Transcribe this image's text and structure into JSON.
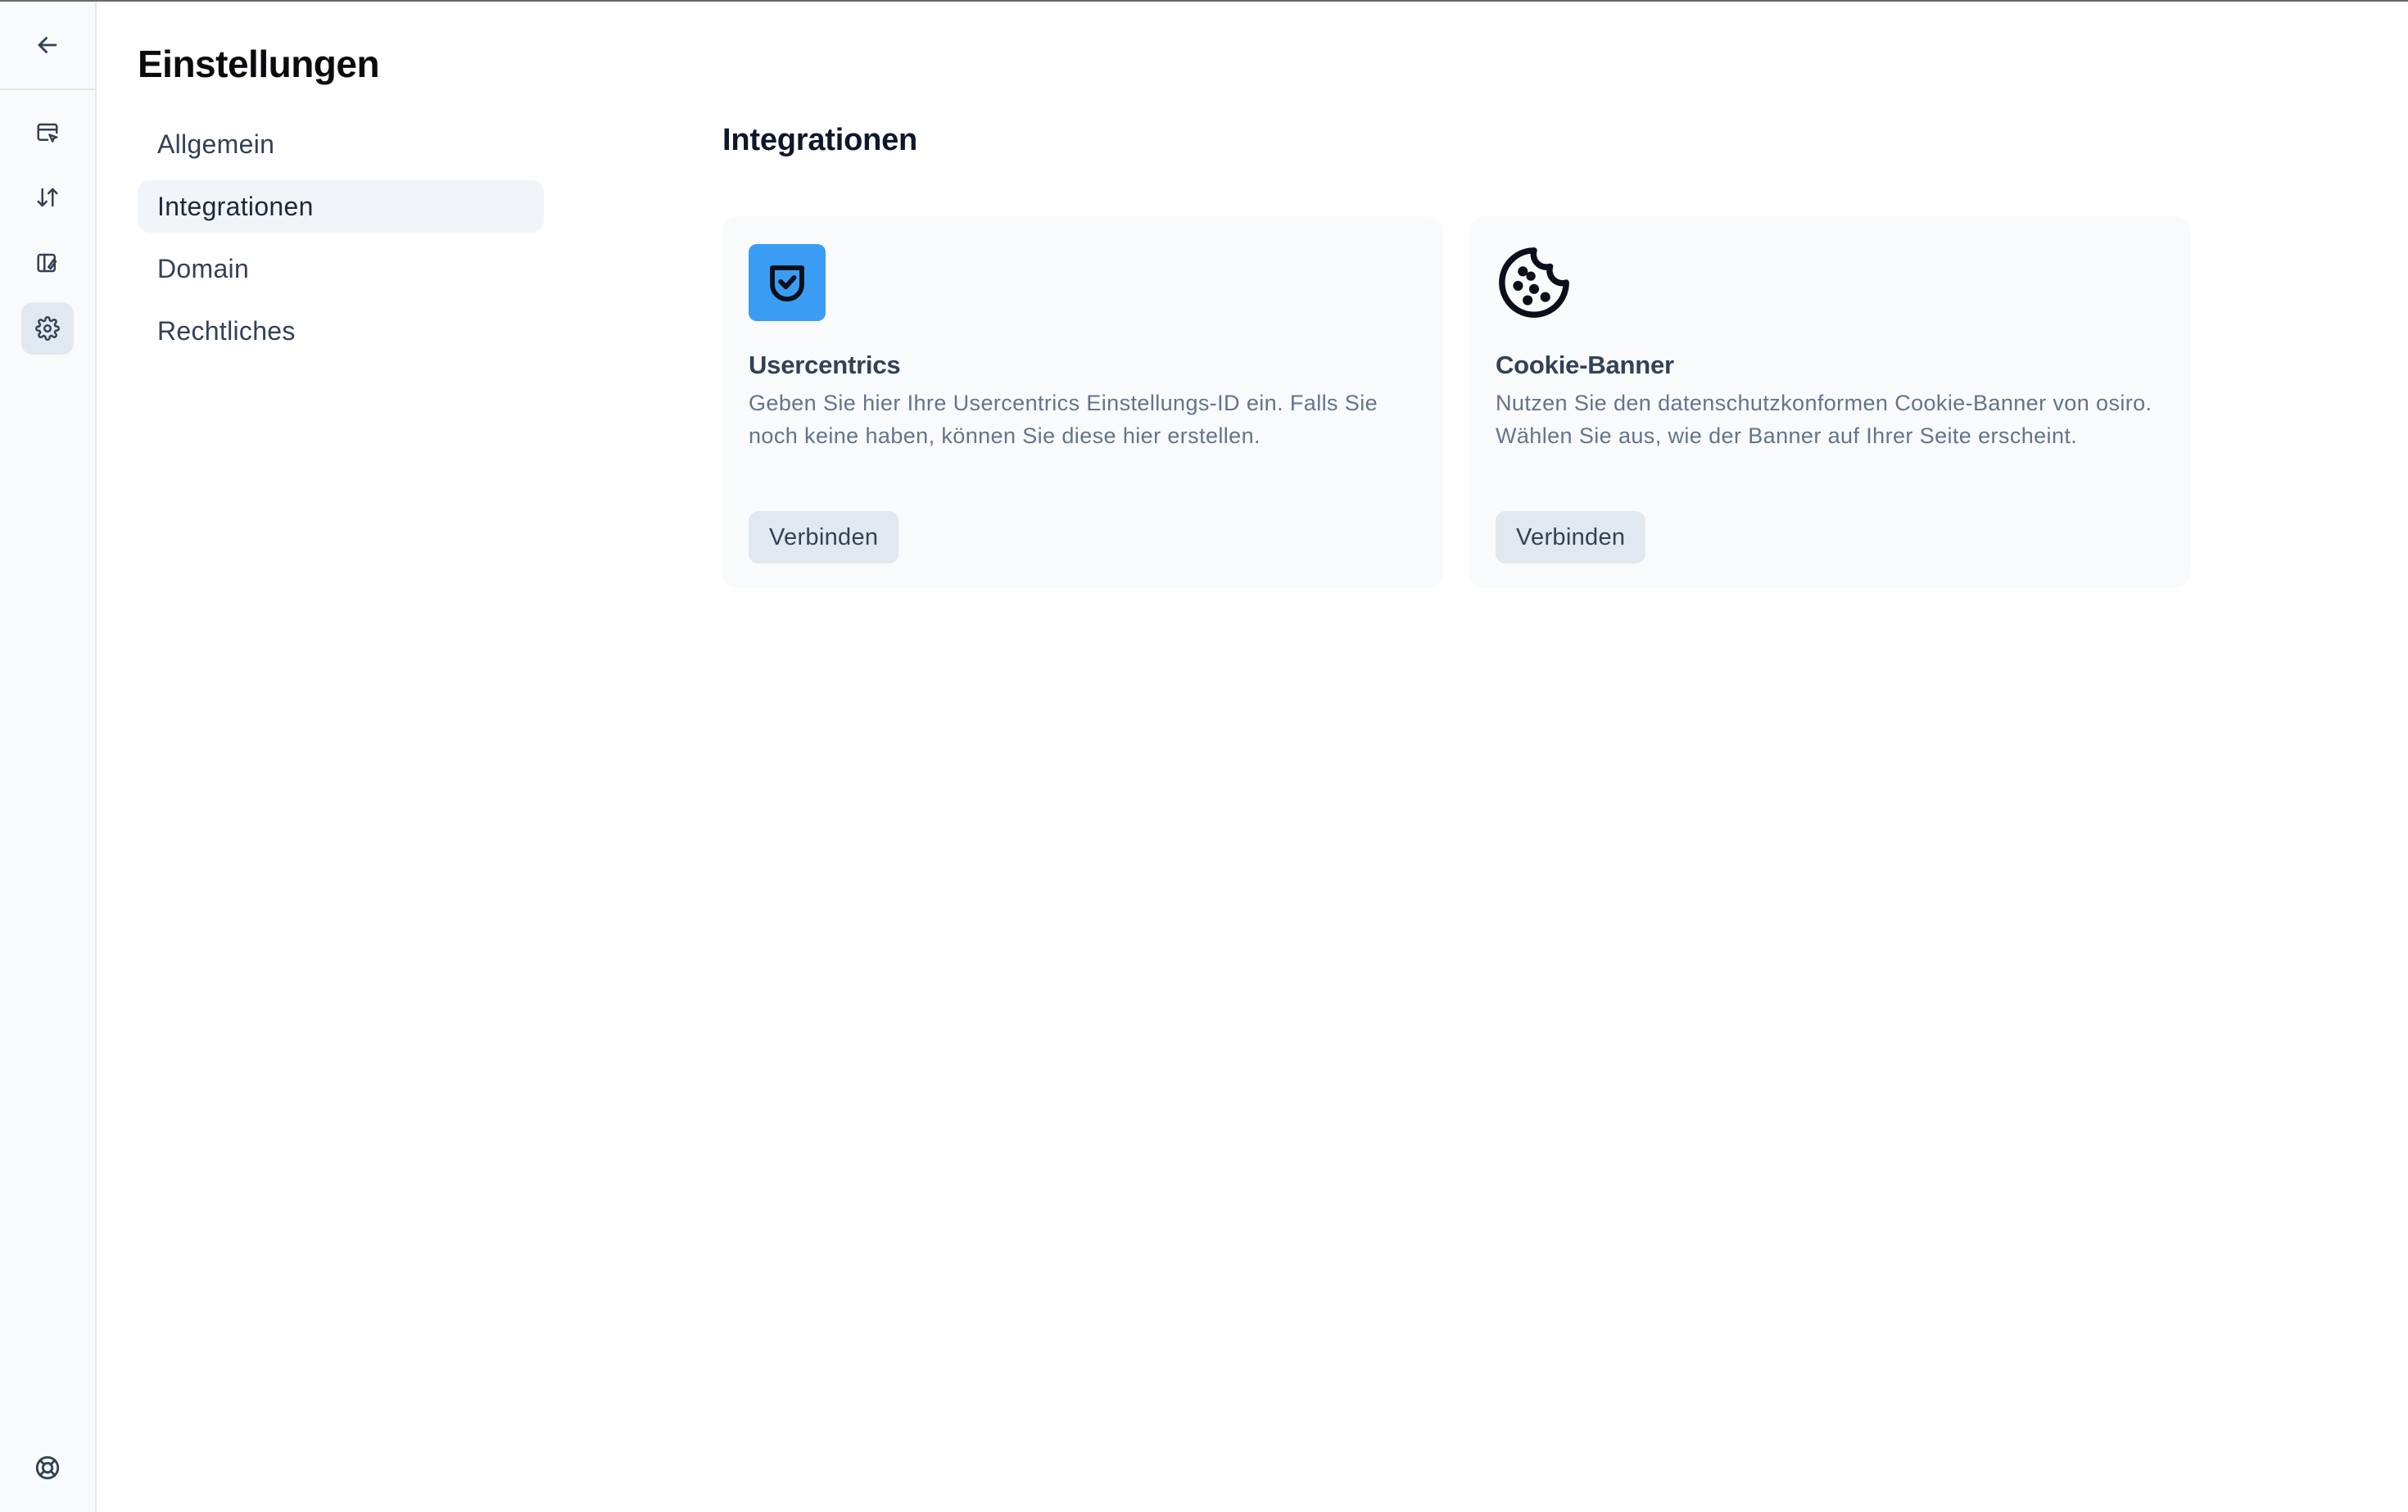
{
  "page": {
    "title": "Einstellungen"
  },
  "rail": {
    "icons": [
      "arrow-left-icon",
      "browser-cursor-icon",
      "arrows-up-down-icon",
      "layout-brush-icon",
      "gear-icon",
      "lifebuoy-icon"
    ],
    "active": "gear-icon"
  },
  "nav": {
    "items": [
      {
        "label": "Allgemein",
        "active": false
      },
      {
        "label": "Integrationen",
        "active": true
      },
      {
        "label": "Domain",
        "active": false
      },
      {
        "label": "Rechtliches",
        "active": false
      }
    ]
  },
  "main": {
    "title": "Integrationen",
    "cards": [
      {
        "icon": "usercentrics-shield-icon",
        "title": "Usercentrics",
        "description": "Geben Sie hier Ihre Usercentrics Einstellungs-ID ein. Falls Sie noch keine haben, können Sie diese hier erstellen.",
        "button": "Verbinden"
      },
      {
        "icon": "cookie-icon",
        "title": "Cookie-Banner",
        "description": "Nutzen Sie den datenschutzkonformen Cookie-Banner von osiro. Wählen Sie aus, wie der Banner auf Ihrer Seite erscheint.",
        "button": "Verbinden"
      }
    ]
  },
  "colors": {
    "accent_blue": "#3b9cf4",
    "active_bg": "#f1f5f9",
    "card_bg": "#f8fafc",
    "button_bg": "#e2e8f0"
  }
}
